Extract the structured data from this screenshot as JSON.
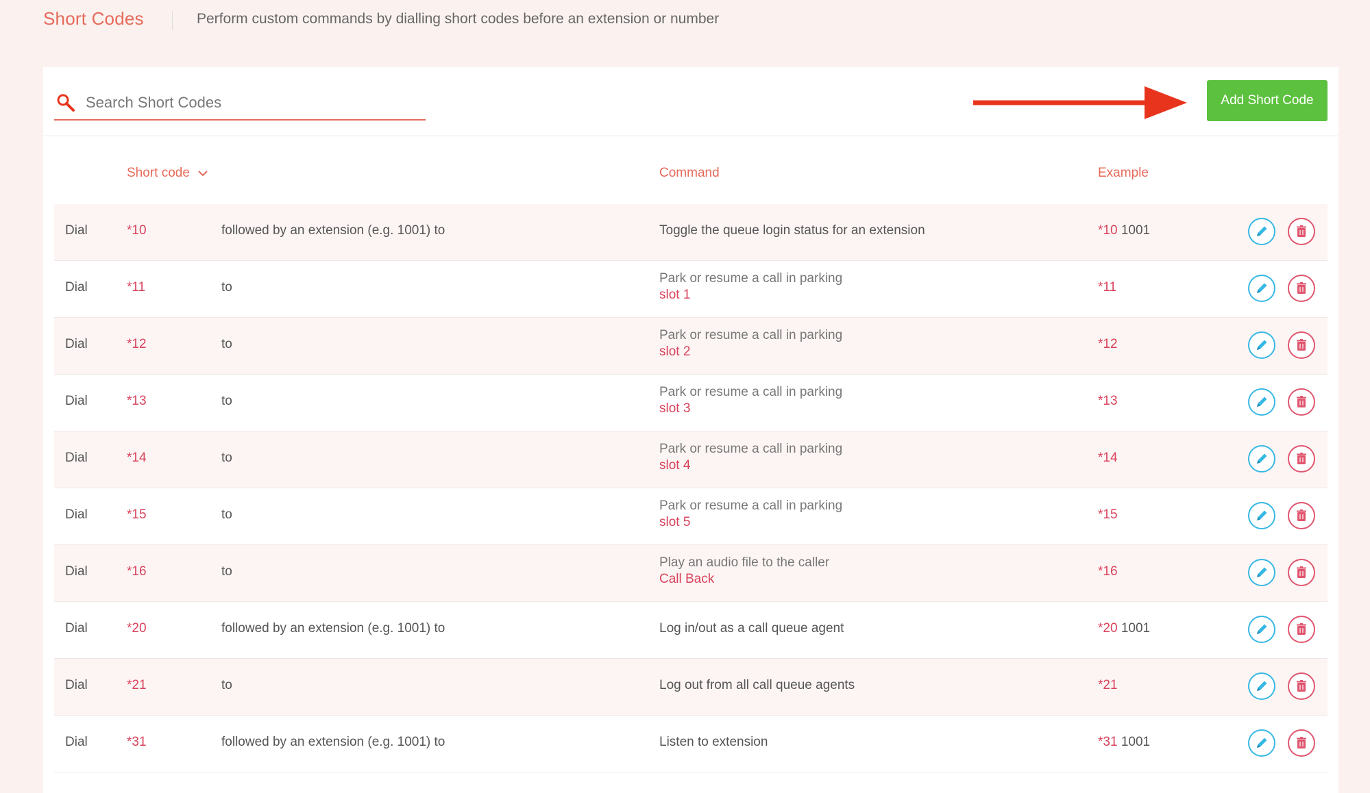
{
  "page": {
    "title": "Short Codes",
    "subtitle": "Perform custom commands by dialling short codes before an extension or number"
  },
  "search": {
    "placeholder": "Search Short Codes"
  },
  "toolbar": {
    "add_label": "Add Short Code"
  },
  "table": {
    "headers": {
      "code": "Short code",
      "command": "Command",
      "example": "Example"
    },
    "rows": [
      {
        "dial": "Dial",
        "code": "*10",
        "follow": "followed by an extension (e.g. 1001) to",
        "command": "Toggle the queue login status for an extension",
        "command_sub": "",
        "example_code": "*10",
        "example_ext": "1001"
      },
      {
        "dial": "Dial",
        "code": "*11",
        "follow": "to",
        "command": "Park or resume a call in parking",
        "command_sub": "slot 1",
        "example_code": "*11",
        "example_ext": ""
      },
      {
        "dial": "Dial",
        "code": "*12",
        "follow": "to",
        "command": "Park or resume a call in parking",
        "command_sub": "slot 2",
        "example_code": "*12",
        "example_ext": ""
      },
      {
        "dial": "Dial",
        "code": "*13",
        "follow": "to",
        "command": "Park or resume a call in parking",
        "command_sub": "slot 3",
        "example_code": "*13",
        "example_ext": ""
      },
      {
        "dial": "Dial",
        "code": "*14",
        "follow": "to",
        "command": "Park or resume a call in parking",
        "command_sub": "slot 4",
        "example_code": "*14",
        "example_ext": ""
      },
      {
        "dial": "Dial",
        "code": "*15",
        "follow": "to",
        "command": "Park or resume a call in parking",
        "command_sub": "slot 5",
        "example_code": "*15",
        "example_ext": ""
      },
      {
        "dial": "Dial",
        "code": "*16",
        "follow": "to",
        "command": "Play an audio file to the caller",
        "command_sub": "Call Back",
        "example_code": "*16",
        "example_ext": ""
      },
      {
        "dial": "Dial",
        "code": "*20",
        "follow": "followed by an extension (e.g. 1001) to",
        "command": "Log in/out as a call queue agent",
        "command_sub": "",
        "example_code": "*20",
        "example_ext": "1001"
      },
      {
        "dial": "Dial",
        "code": "*21",
        "follow": "to",
        "command": "Log out from all call queue agents",
        "command_sub": "",
        "example_code": "*21",
        "example_ext": ""
      },
      {
        "dial": "Dial",
        "code": "*31",
        "follow": "followed by an extension (e.g. 1001) to",
        "command": "Listen to extension",
        "command_sub": "",
        "example_code": "*31",
        "example_ext": "1001"
      }
    ]
  },
  "icons": {
    "search": "search-icon",
    "sort": "chevron-down-icon",
    "edit": "pencil-icon",
    "delete": "trash-icon",
    "arrow": "arrow-right-icon"
  },
  "colors": {
    "accent": "#e66a5a",
    "code_red": "#d9425c",
    "add_green": "#5cc13e",
    "edit_blue": "#37b8e4",
    "delete_red": "#e0566f",
    "arrow_red": "#e8341c"
  }
}
